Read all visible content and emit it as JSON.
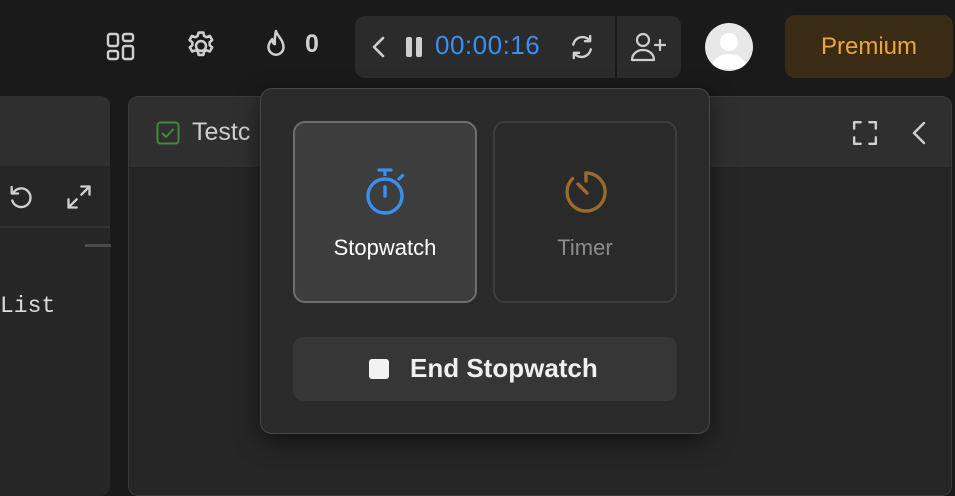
{
  "topbar": {
    "streak_count": "0",
    "timer": {
      "time": "00:00:16"
    },
    "premium_label": "Premium"
  },
  "left_panel": {
    "code_fragment": "List"
  },
  "right_panel": {
    "title": "Testc"
  },
  "popover": {
    "modes": [
      {
        "label": "Stopwatch",
        "selected": true
      },
      {
        "label": "Timer",
        "selected": false
      }
    ],
    "end_label": "End Stopwatch"
  },
  "colors": {
    "timer_blue": "#3b8ff0",
    "premium_orange": "#f2a43b",
    "stopwatch_icon_blue": "#3b8ff0",
    "timer_icon_brown": "#9a6a2e",
    "testcase_check_green": "#3f8a3f"
  },
  "icons": [
    "layout-grid-icon",
    "gear-icon",
    "flame-icon",
    "chevron-left-icon",
    "pause-icon",
    "reset-icon",
    "add-user-icon",
    "avatar-user-icon",
    "undo-icon",
    "expand-icon",
    "checkbox-check-icon",
    "fullscreen-icon",
    "collapse-chevron-icon",
    "stopwatch-icon",
    "timer-icon",
    "stop-square-icon"
  ]
}
